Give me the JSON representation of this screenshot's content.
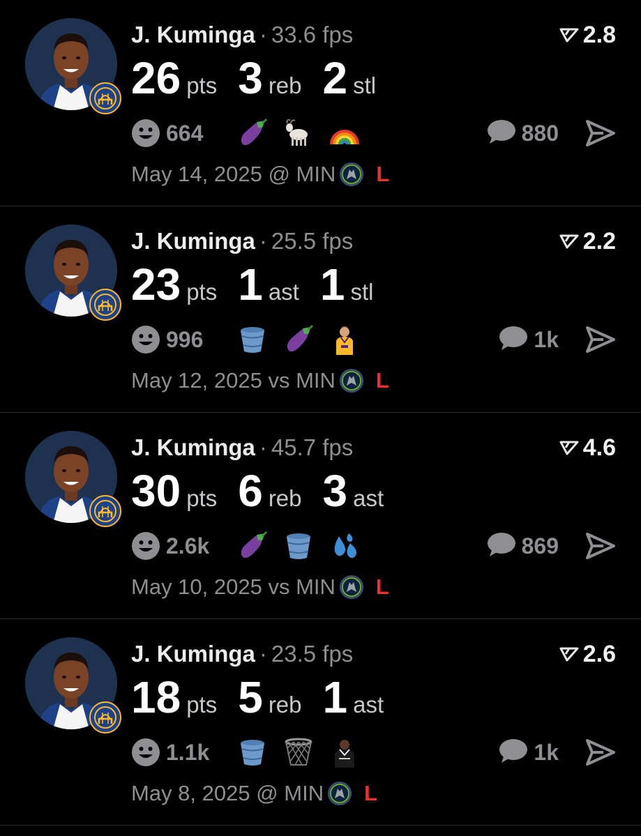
{
  "theme": {
    "background": "#000000",
    "muted_text": "#8e8e93",
    "loss_color": "#e8332a",
    "divider": "#2b2b2e"
  },
  "posts": [
    {
      "player": "J. Kuminga",
      "separator": "·",
      "fps": "33.6 fps",
      "rating": "2.8",
      "stats": [
        {
          "value": "26",
          "label": "pts"
        },
        {
          "value": "3",
          "label": "reb"
        },
        {
          "value": "2",
          "label": "stl"
        }
      ],
      "reaction_count": "664",
      "emojis": [
        "eggplant-icon",
        "goat-icon",
        "rainbow-icon"
      ],
      "comment_count": "880",
      "game": "May 14, 2025 @ MIN",
      "result": "L"
    },
    {
      "player": "J. Kuminga",
      "separator": "·",
      "fps": "25.5 fps",
      "rating": "2.2",
      "stats": [
        {
          "value": "23",
          "label": "pts"
        },
        {
          "value": "1",
          "label": "ast"
        },
        {
          "value": "1",
          "label": "stl"
        }
      ],
      "reaction_count": "996",
      "emojis": [
        "bucket-icon",
        "eggplant-icon",
        "player-yellow-jersey-icon"
      ],
      "comment_count": "1k",
      "game": "May 12, 2025 vs MIN",
      "result": "L"
    },
    {
      "player": "J. Kuminga",
      "separator": "·",
      "fps": "45.7 fps",
      "rating": "4.6",
      "stats": [
        {
          "value": "30",
          "label": "pts"
        },
        {
          "value": "6",
          "label": "reb"
        },
        {
          "value": "3",
          "label": "ast"
        }
      ],
      "reaction_count": "2.6k",
      "emojis": [
        "eggplant-icon",
        "bucket-icon",
        "sweat-droplets-icon"
      ],
      "comment_count": "869",
      "game": "May 10, 2025 vs MIN",
      "result": "L"
    },
    {
      "player": "J. Kuminga",
      "separator": "·",
      "fps": "23.5 fps",
      "rating": "2.6",
      "stats": [
        {
          "value": "18",
          "label": "pts"
        },
        {
          "value": "5",
          "label": "reb"
        },
        {
          "value": "1",
          "label": "ast"
        }
      ],
      "reaction_count": "1.1k",
      "emojis": [
        "bucket-icon",
        "basketball-net-icon",
        "player-black-jersey-icon"
      ],
      "comment_count": "1k",
      "game": "May 8, 2025 @ MIN",
      "result": "L"
    }
  ]
}
